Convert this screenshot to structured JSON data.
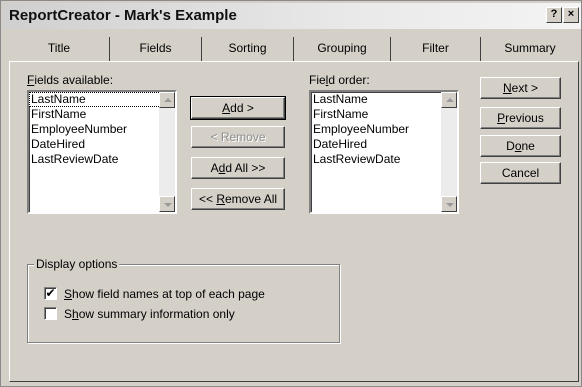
{
  "window": {
    "title": "ReportCreator - Mark's Example",
    "help_button": "?",
    "close_button": "×"
  },
  "tabs": [
    {
      "label": "Title",
      "active": false
    },
    {
      "label": "Fields",
      "active": true
    },
    {
      "label": "Sorting",
      "active": false
    },
    {
      "label": "Grouping",
      "active": false
    },
    {
      "label": "Filter",
      "active": false
    },
    {
      "label": "Summary",
      "active": false
    }
  ],
  "fields_available": {
    "label_mnemonic": "F",
    "label_rest": "ields available:",
    "items": [
      "LastName",
      "FirstName",
      "EmployeeNumber",
      "DateHired",
      "LastReviewDate"
    ],
    "selected_index": 0
  },
  "field_order": {
    "label_pre": "Fie",
    "label_mnemonic": "l",
    "label_rest": "d order:",
    "items": [
      "LastName",
      "FirstName",
      "EmployeeNumber",
      "DateHired",
      "LastReviewDate"
    ]
  },
  "middle_buttons": {
    "add": {
      "mnemonic": "A",
      "rest": "dd >"
    },
    "remove": {
      "label": "< Remove",
      "enabled": false
    },
    "add_all": {
      "pre": "A",
      "mnemonic": "d",
      "rest": "d All >>"
    },
    "remove_all": {
      "pre": "<< ",
      "mnemonic": "R",
      "rest": "emove All"
    }
  },
  "right_buttons": {
    "next": {
      "mnemonic": "N",
      "rest": "ext >"
    },
    "previous": {
      "mnemonic": "P",
      "rest": "revious"
    },
    "done": {
      "pre": "D",
      "mnemonic": "o",
      "rest": "ne"
    },
    "cancel": {
      "label": "Cancel"
    }
  },
  "display_options": {
    "title": "Display options",
    "show_field_names": {
      "mnemonic": "S",
      "rest": "how field names at top of each page",
      "checked": true
    },
    "show_summary": {
      "pre": "S",
      "mnemonic": "h",
      "rest": "ow summary information only",
      "checked": false
    }
  },
  "check_mark": "✔"
}
